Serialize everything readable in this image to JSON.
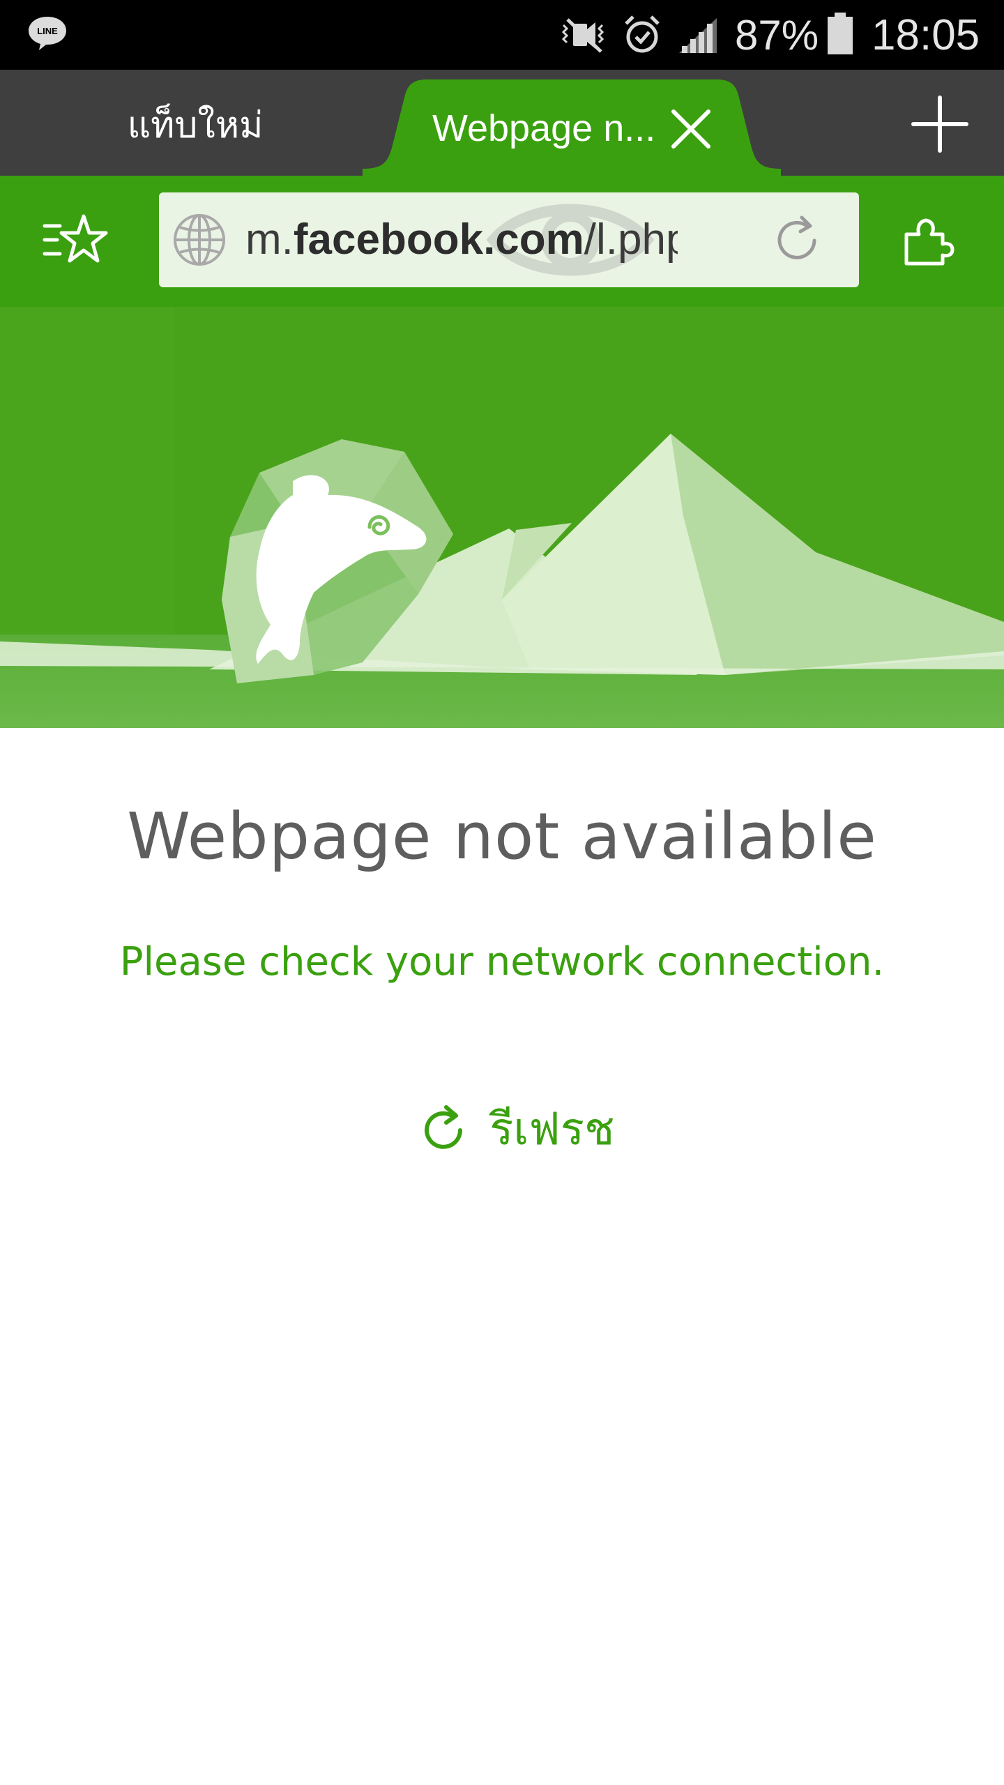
{
  "status_bar": {
    "battery_percent": "87%",
    "time": "18:05",
    "icons": [
      "line-app-icon",
      "mute-vibrate-icon",
      "alarm-icon",
      "signal-icon",
      "battery-icon"
    ]
  },
  "tabs": {
    "items": [
      {
        "label": "แท็บใหม่",
        "active": false
      },
      {
        "label": "Webpage n...",
        "active": true
      }
    ],
    "active_color": "#3aa00f",
    "strip_color": "#3f3f3f"
  },
  "toolbar": {
    "url_prefix": "m.",
    "url_domain": "facebook.com",
    "url_suffix": "/l.php...",
    "background_color": "#3aa00f"
  },
  "error": {
    "title": "Webpage not available",
    "message": "Please check your network connection.",
    "refresh_label": "รีเฟรช",
    "accent_color": "#3aa00f"
  }
}
